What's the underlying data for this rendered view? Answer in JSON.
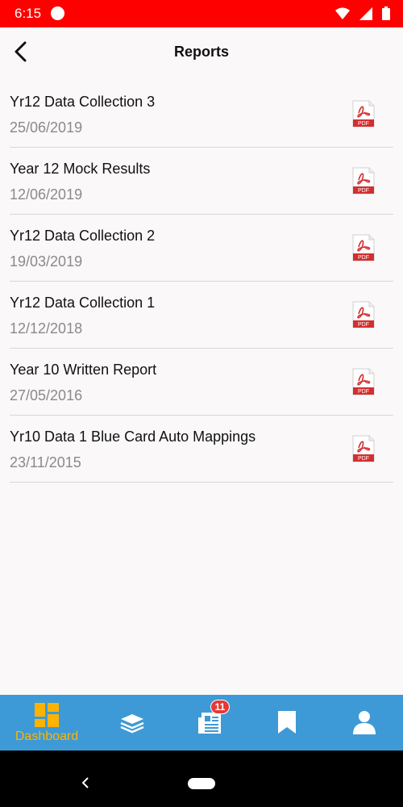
{
  "status_bar": {
    "time": "6:15",
    "icons": [
      "record-icon",
      "wifi-icon",
      "signal-icon",
      "battery-icon"
    ]
  },
  "header": {
    "title": "Reports",
    "back_icon": "chevron-left-icon"
  },
  "reports": [
    {
      "title": "Yr12 Data Collection 3",
      "date": "25/06/2019",
      "icon": "pdf-icon"
    },
    {
      "title": "Year 12 Mock Results",
      "date": "12/06/2019",
      "icon": "pdf-icon"
    },
    {
      "title": "Yr12 Data Collection 2",
      "date": "19/03/2019",
      "icon": "pdf-icon"
    },
    {
      "title": "Yr12 Data Collection 1",
      "date": "12/12/2018",
      "icon": "pdf-icon"
    },
    {
      "title": "Year 10 Written Report",
      "date": "27/05/2016",
      "icon": "pdf-icon"
    },
    {
      "title": "Yr10 Data 1 Blue Card Auto Mappings",
      "date": "23/11/2015",
      "icon": "pdf-icon"
    }
  ],
  "bottom_nav": {
    "items": [
      {
        "label": "Dashboard",
        "icon": "dashboard-icon",
        "active": true
      },
      {
        "label": "",
        "icon": "stack-icon"
      },
      {
        "label": "",
        "icon": "newspaper-icon",
        "badge": "11"
      },
      {
        "label": "",
        "icon": "bookmark-icon"
      },
      {
        "label": "",
        "icon": "profile-icon"
      }
    ]
  },
  "colors": {
    "status_bar": "#ff0000",
    "nav_background": "#3d9ad6",
    "active_tab": "#ffb300",
    "badge": "#e53935",
    "pdf_red": "#d32f2f"
  }
}
